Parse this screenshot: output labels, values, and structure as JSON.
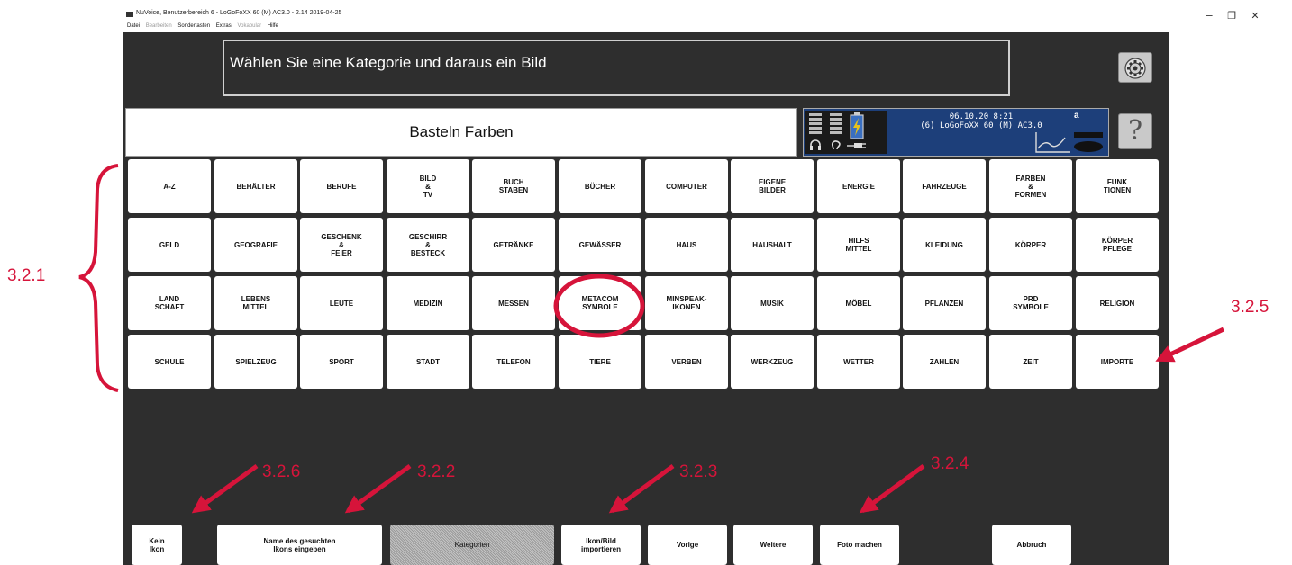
{
  "window": {
    "title": "NuVoice, Benutzerbereich 6 - LoGoFoXX 60 (M) AC3.0 - 2.14 2019-04-25",
    "menu": [
      {
        "label": "Datei",
        "enabled": true
      },
      {
        "label": "Bearbeiten",
        "enabled": false
      },
      {
        "label": "Sondertasten",
        "enabled": true
      },
      {
        "label": "Extras",
        "enabled": true
      },
      {
        "label": "Vokabular",
        "enabled": false
      },
      {
        "label": "Hilfe",
        "enabled": true
      }
    ],
    "controls": {
      "minimize": "–",
      "maximize": "❐",
      "close": "✕"
    }
  },
  "instruction": "Wählen Sie eine Kategorie und daraus ein Bild",
  "category_title": "Basteln Farben",
  "status": {
    "datetime": "06.10.20 8:21",
    "device": "(6) LoGoFoXX 60 (M) AC3.0",
    "mode_letter": "a"
  },
  "help_label": "?",
  "categories": [
    [
      "A-Z",
      "BEHÄLTER",
      "BERUFE",
      "BILD\n&\nTV",
      "BUCH\nSTABEN",
      "BÜCHER",
      "COMPUTER",
      "EIGENE\nBILDER",
      "ENERGIE",
      "FAHRZEUGE",
      "FARBEN\n&\nFORMEN",
      "FUNK\nTIONEN"
    ],
    [
      "GELD",
      "GEOGRAFIE",
      "GESCHENK\n&\nFEIER",
      "GESCHIRR\n&\nBESTECK",
      "GETRÄNKE",
      "GEWÄSSER",
      "HAUS",
      "HAUSHALT",
      "HILFS\nMITTEL",
      "KLEIDUNG",
      "KÖRPER",
      "KÖRPER\nPFLEGE"
    ],
    [
      "LAND\nSCHAFT",
      "LEBENS\nMITTEL",
      "LEUTE",
      "MEDIZIN",
      "MESSEN",
      "METACOM\nSYMBOLE",
      "MINSPEAK-\nIKONEN",
      "MUSIK",
      "MÖBEL",
      "PFLANZEN",
      "PRD\nSYMBOLE",
      "RELIGION"
    ],
    [
      "SCHULE",
      "SPIELZEUG",
      "SPORT",
      "STADT",
      "TELEFON",
      "TIERE",
      "VERBEN",
      "WERKZEUG",
      "WETTER",
      "ZAHLEN",
      "ZEIT",
      "IMPORTE"
    ]
  ],
  "bottom_buttons": {
    "kein_ikon": "Kein\nIkon",
    "name_eingeben": "Name des gesuchten\nIkons eingeben",
    "kategorien": "Kategorien",
    "importieren": "Ikon/Bild\nimportieren",
    "vorige": "Vorige",
    "weitere": "Weitere",
    "foto": "Foto machen",
    "abbruch": "Abbruch"
  },
  "annotations": {
    "a321": "3.2.1",
    "a322": "3.2.2",
    "a323": "3.2.3",
    "a324": "3.2.4",
    "a325": "3.2.5",
    "a326": "3.2.6"
  },
  "colors": {
    "annotation": "#d6143a",
    "background": "#2e2e2e",
    "status_panel": "#1d3f7a",
    "battery": "#e8c21a"
  }
}
